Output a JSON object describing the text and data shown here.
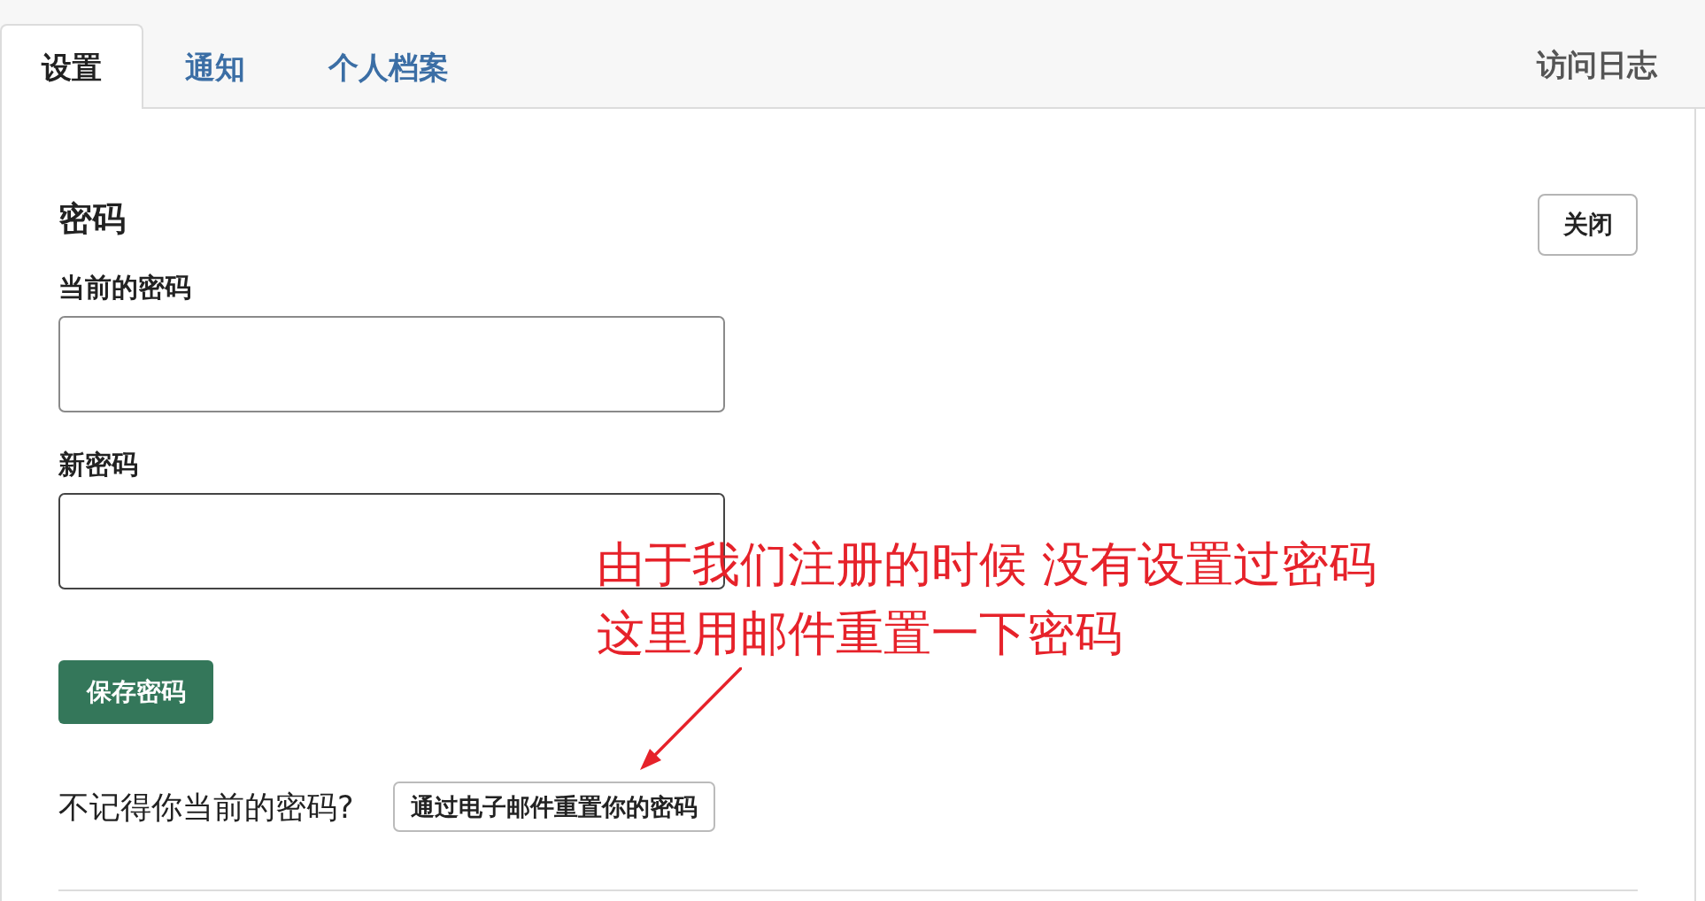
{
  "tabs": [
    {
      "label": "设置",
      "selected": true
    },
    {
      "label": "通知",
      "selected": false
    },
    {
      "label": "个人档案",
      "selected": false
    }
  ],
  "side_link": {
    "label": "访问日志"
  },
  "password_section": {
    "title": "密码",
    "close_button": "关闭",
    "fields": [
      {
        "label": "当前的密码",
        "focused": false
      },
      {
        "label": "新密码",
        "focused": true
      }
    ],
    "save_button": "保存密码",
    "forgot_prompt": "不记得你当前的密码?",
    "reset_button": "通过电子邮件重置你的密码"
  },
  "annotation": {
    "lines": [
      "由于我们注册的时候 没有设置过密码",
      "这里用邮件重置一下密码"
    ]
  }
}
